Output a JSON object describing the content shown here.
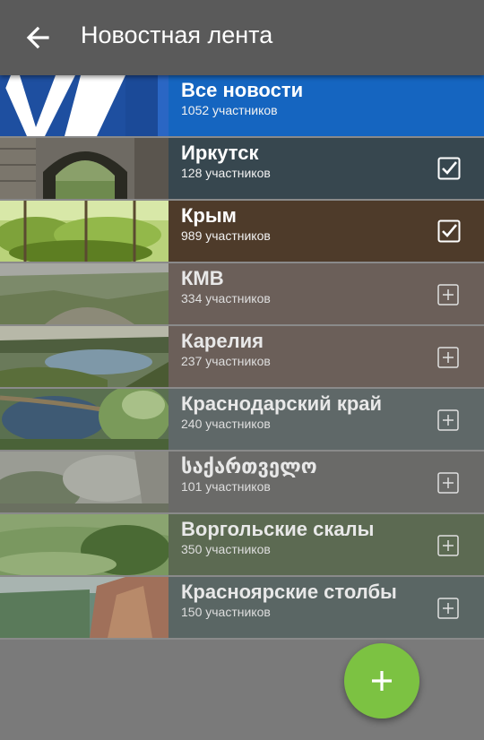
{
  "appbar": {
    "title": "Новостная лента",
    "back_icon": "arrow-left-icon"
  },
  "groups": [
    {
      "name": "Все новости",
      "members": "1052 участников",
      "state": "none",
      "bg": "#1565c0"
    },
    {
      "name": "Иркутск",
      "members": "128 участников",
      "state": "checked",
      "bg": "#37474f"
    },
    {
      "name": "Крым",
      "members": "989 участников",
      "state": "checked",
      "bg": "#4e3b2a"
    },
    {
      "name": "КМВ",
      "members": "334 участников",
      "state": "add",
      "bg": "#6b5f59"
    },
    {
      "name": "Карелия",
      "members": "237 участников",
      "state": "add",
      "bg": "#6b5f59"
    },
    {
      "name": "Краснодарский край",
      "members": "240 участников",
      "state": "add",
      "bg": "#5f6868"
    },
    {
      "name": "საქართველო",
      "members": "101 участников",
      "state": "add",
      "bg": "#6a6a68"
    },
    {
      "name": "Воргольские скалы",
      "members": "350 участников",
      "state": "add",
      "bg": "#5c6a52"
    },
    {
      "name": "Красноярские столбы",
      "members": "150 участников",
      "state": "add",
      "bg": "#5a6664"
    }
  ],
  "fab": {
    "icon": "plus-icon",
    "color": "#7cc242"
  }
}
